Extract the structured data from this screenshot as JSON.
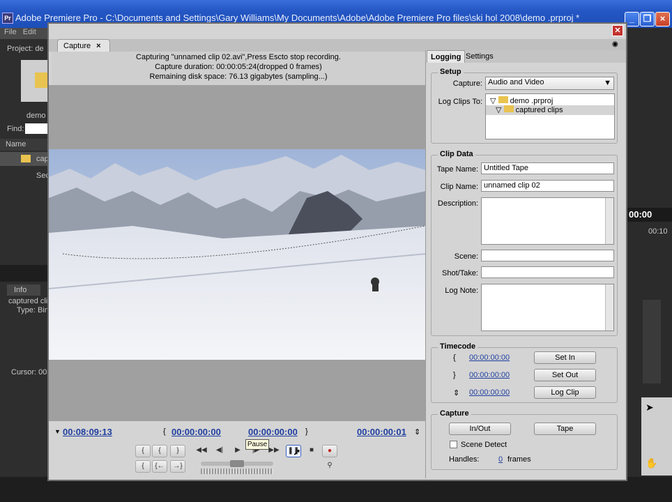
{
  "app": {
    "title": "Adobe Premiere Pro - C:\\Documents and Settings\\Gary Williams\\My Documents\\Adobe\\Adobe Premiere Pro files\\ski hol 2008\\demo .prproj *",
    "logo": "Pr"
  },
  "menu": {
    "file": "File",
    "edit": "Edit"
  },
  "left_panel": {
    "project_label": "Project: de",
    "file_label": "demo",
    "find_label": "Find:",
    "name_header": "Name",
    "row1": "capt",
    "row2": "Sec",
    "info_tab": "Info",
    "info_line1": "captured cli",
    "info_line2": "Type: Bin",
    "cursor_label": "Cursor: 00"
  },
  "right_bg": {
    "timecode": "00:00",
    "timecode2": "00:10"
  },
  "capture_tab": {
    "label": "Capture",
    "close": "×"
  },
  "status": {
    "line1": "Capturing \"unnamed clip 02.avi\",Press Escto stop recording.",
    "line2": "Capture duration: 00:00:05:24(dropped 0 frames)",
    "line3": "Remaining disk space: 76.13 gigabytes (sampling...)"
  },
  "transport": {
    "current": "00:08:09:13",
    "in_point": "00:00:00:00",
    "out_point": "00:00:00:00",
    "duration": "00:00:00:01",
    "tooltip": "Pause"
  },
  "tabs": {
    "logging": "Logging",
    "settings": "Settings"
  },
  "setup": {
    "title": "Setup",
    "capture_label": "Capture:",
    "capture_value": "Audio and Video",
    "logclips_label": "Log Clips To:",
    "tree_root": "demo .prproj",
    "tree_child": "captured clips"
  },
  "clip_data": {
    "title": "Clip Data",
    "tape_name_label": "Tape Name:",
    "tape_name_value": "Untitled Tape",
    "clip_name_label": "Clip Name:",
    "clip_name_value": "unnamed clip 02",
    "description_label": "Description:",
    "scene_label": "Scene:",
    "shot_label": "Shot/Take:",
    "lognote_label": "Log Note:"
  },
  "timecode": {
    "title": "Timecode",
    "in": "00:00:00:00",
    "out": "00:00:00:00",
    "dur": "00:00:00:00",
    "set_in": "Set In",
    "set_out": "Set Out",
    "log_clip": "Log Clip"
  },
  "capture": {
    "title": "Capture",
    "in_out": "In/Out",
    "tape": "Tape",
    "scene_detect": "Scene Detect",
    "handles_label": "Handles:",
    "handles_value": "0",
    "frames": "frames"
  },
  "colors": {
    "accent_blue": "#1f3fa0",
    "title_blue": "#2456c4"
  }
}
